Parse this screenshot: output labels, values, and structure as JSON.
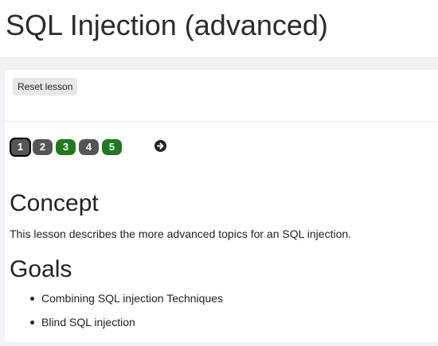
{
  "header": {
    "title": "SQL Injection (advanced)"
  },
  "toolbar": {
    "reset_label": "Reset lesson"
  },
  "pagination": {
    "pages": [
      {
        "label": "1",
        "state": "current"
      },
      {
        "label": "2",
        "state": "default"
      },
      {
        "label": "3",
        "state": "completed"
      },
      {
        "label": "4",
        "state": "default"
      },
      {
        "label": "5",
        "state": "completed"
      }
    ],
    "next_icon": "arrow-right-circle-icon"
  },
  "concept": {
    "heading": "Concept",
    "text": "This lesson describes the more advanced topics for an SQL injection."
  },
  "goals": {
    "heading": "Goals",
    "items": [
      "Combining SQL injection Techniques",
      "Blind SQL injection"
    ]
  },
  "colors": {
    "completed": "#1f7a1f",
    "default": "#555555",
    "current_border": "#000000"
  }
}
